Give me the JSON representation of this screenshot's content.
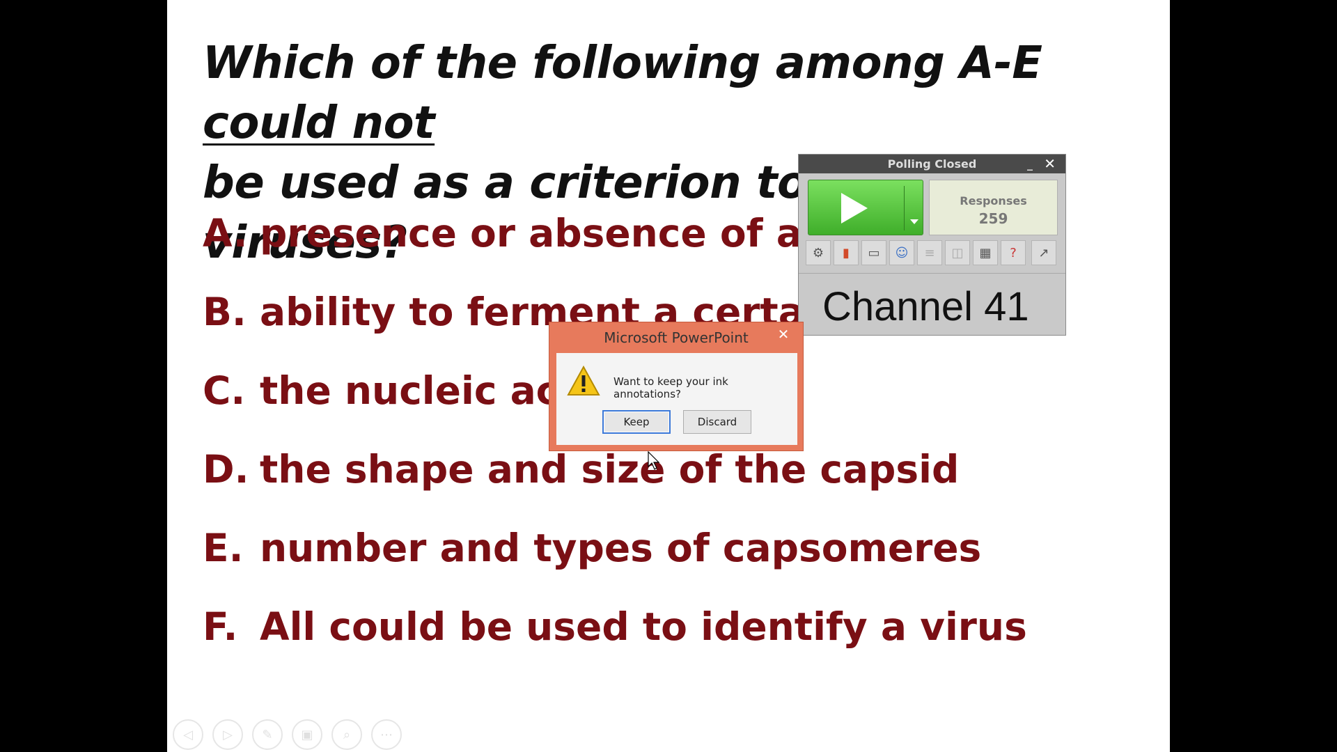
{
  "slide": {
    "question_part1": "Which of the following among A-E ",
    "question_underlined": "could not",
    "question_part2": "be used as a criterion to identify viruses?",
    "options": [
      {
        "letter": "A.",
        "text": "presence or absence of an en"
      },
      {
        "letter": "B.",
        "text": "ability to ferment a certain ca"
      },
      {
        "letter": "C.",
        "text": "the nucleic acid"
      },
      {
        "letter": "D.",
        "text": "the shape and size of the capsid"
      },
      {
        "letter": "E.",
        "text": "number and types of capsomeres"
      },
      {
        "letter": "F.",
        "text": "All could be used to identify a virus"
      }
    ],
    "nav_icons": [
      "previous-icon",
      "next-icon",
      "pen-icon",
      "slides-icon",
      "zoom-icon",
      "more-icon"
    ],
    "colors": {
      "option_text": "#7a0f14",
      "question_text": "#111111"
    }
  },
  "poll": {
    "title": "Polling Closed",
    "minimize": "_",
    "close": "✕",
    "responses_label": "Responses",
    "responses_count": "259",
    "channel": "Channel 41",
    "tools": [
      "gear-icon",
      "bar-chart-icon",
      "monitor-icon",
      "participants-icon",
      "list-icon",
      "stack-icon",
      "grid-icon",
      "question-icon",
      "export-icon"
    ]
  },
  "dialog": {
    "title": "Microsoft PowerPoint",
    "close": "✕",
    "message": "Want to keep your ink annotations?",
    "keep_label": "Keep",
    "discard_label": "Discard"
  }
}
